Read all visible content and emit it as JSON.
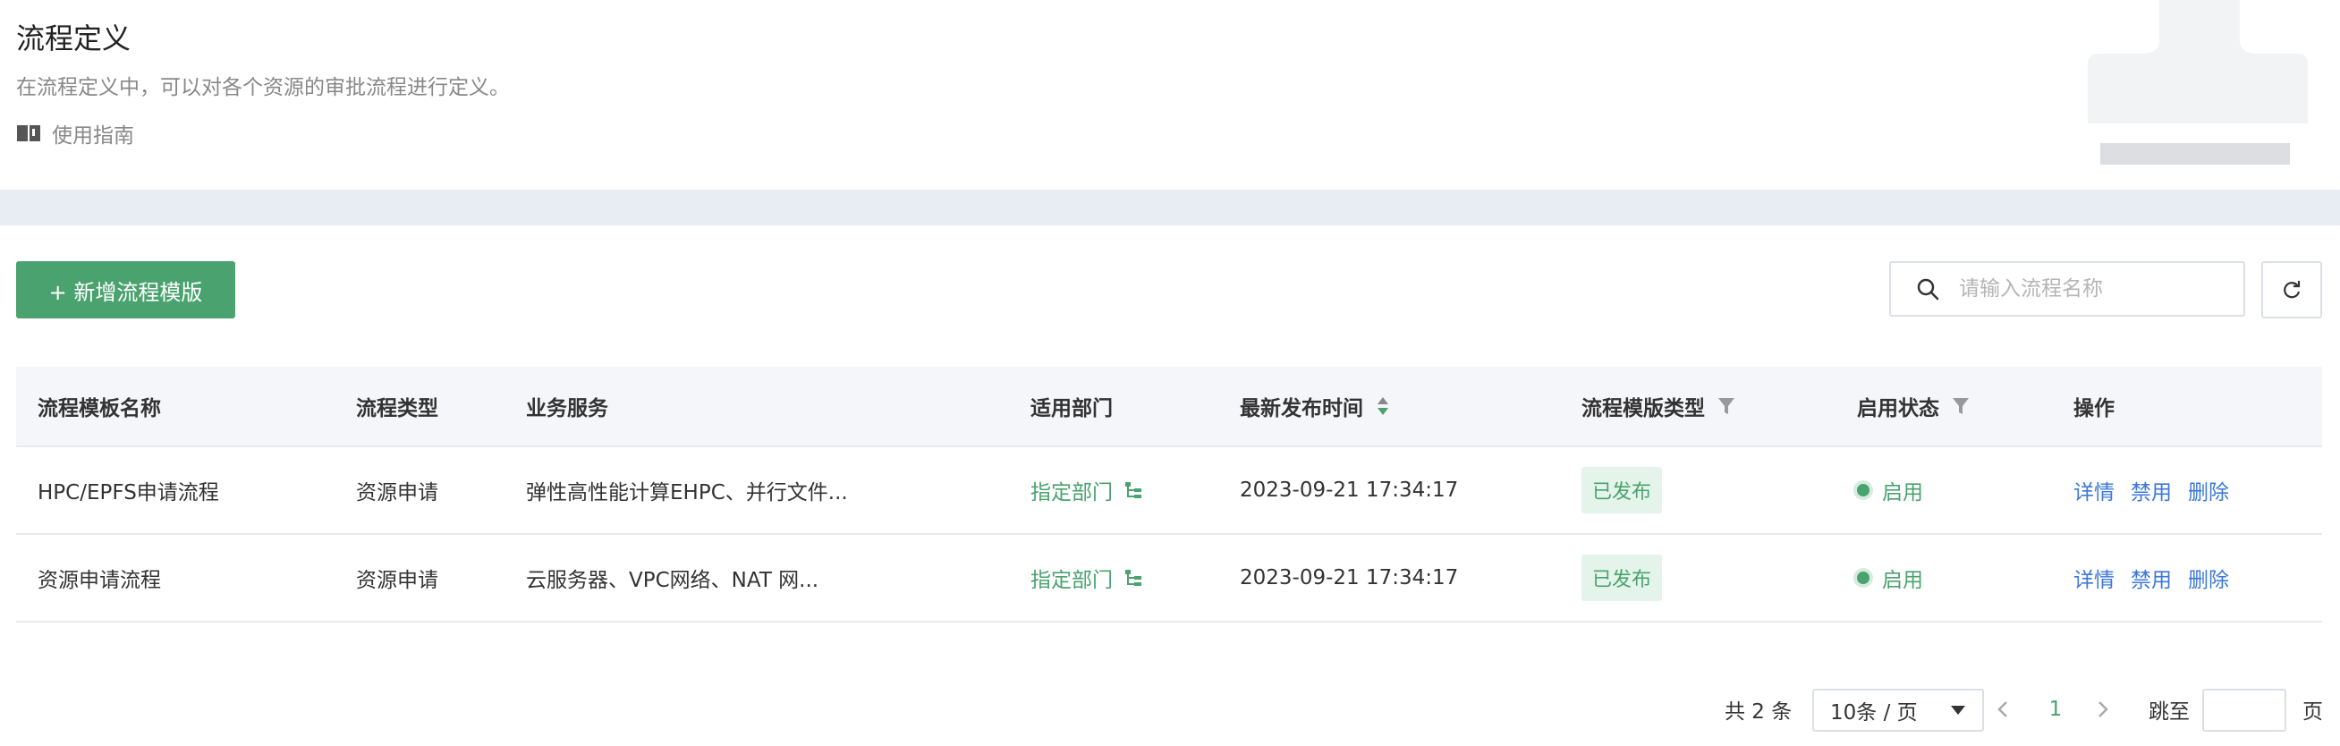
{
  "header": {
    "title": "流程定义",
    "description": "在流程定义中，可以对各个资源的审批流程进行定义。",
    "guide_label": "使用指南"
  },
  "toolbar": {
    "add_label": "+ 新增流程模版",
    "search_placeholder": "请输入流程名称"
  },
  "table": {
    "columns": [
      "流程模板名称",
      "流程类型",
      "业务服务",
      "适用部门",
      "最新发布时间",
      "流程模版类型",
      "启用状态",
      "操作"
    ],
    "rows": [
      {
        "name": "HPC/EPFS申请流程",
        "type": "资源申请",
        "service": "弹性高性能计算EHPC、并行文件...",
        "dept": "指定部门",
        "time": "2023-09-21 17:34:17",
        "template_type": "已发布",
        "status": "启用",
        "actions": [
          "详情",
          "禁用",
          "删除"
        ]
      },
      {
        "name": "资源申请流程",
        "type": "资源申请",
        "service": "云服务器、VPC网络、NAT 网...",
        "dept": "指定部门",
        "time": "2023-09-21 17:34:17",
        "template_type": "已发布",
        "status": "启用",
        "actions": [
          "详情",
          "禁用",
          "删除"
        ]
      }
    ]
  },
  "pagination": {
    "total_label": "共 2 条",
    "page_size": "10条 / 页",
    "current_page": "1",
    "jump_label": "跳至",
    "page_suffix": "页"
  },
  "colors": {
    "accent": "#4aa26f",
    "link": "#3c78d8",
    "band": "#e8ecf3"
  }
}
